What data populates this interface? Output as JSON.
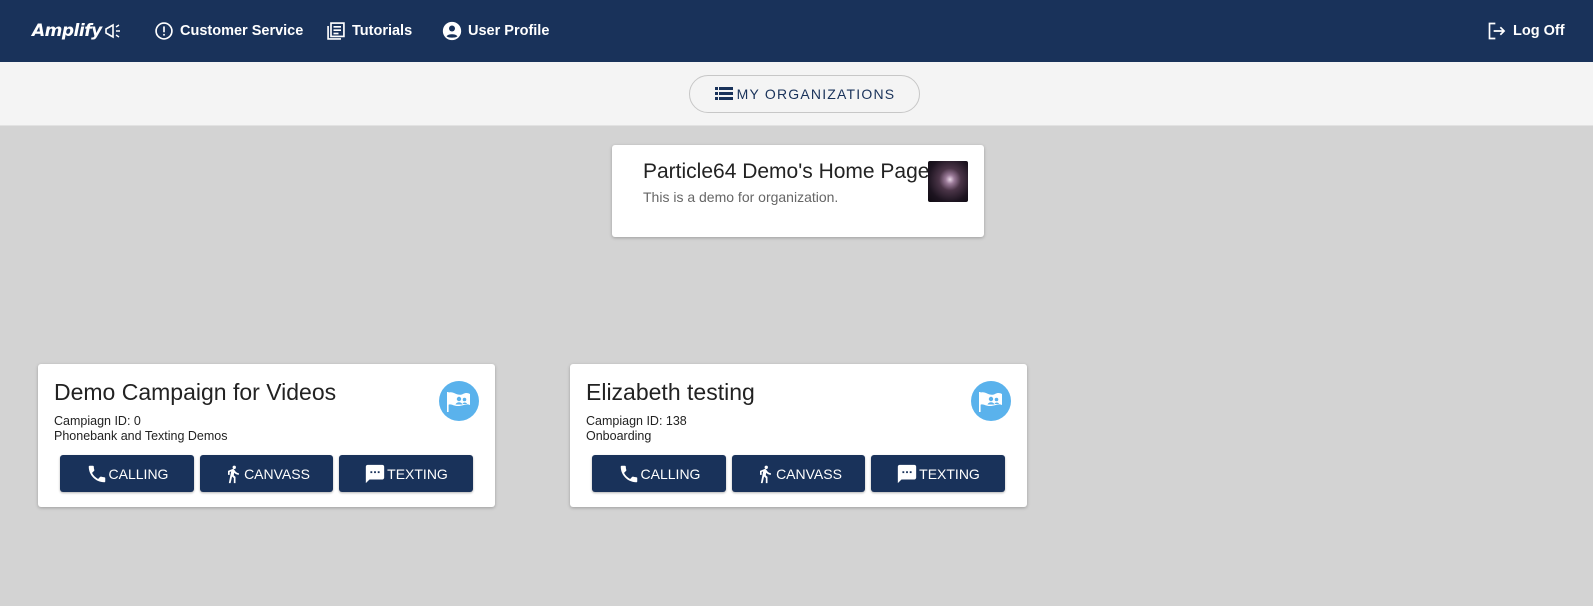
{
  "nav": {
    "logo_text": "Amplify",
    "links": [
      {
        "label": "Customer Service",
        "icon": "alert-circle-icon"
      },
      {
        "label": "Tutorials",
        "icon": "newspaper-icon"
      },
      {
        "label": "User Profile",
        "icon": "account-circle-icon"
      }
    ],
    "logout_label": "Log Off"
  },
  "subheader": {
    "my_orgs_label": "MY ORGANIZATIONS"
  },
  "organization": {
    "title": "Particle64 Demo's Home Page",
    "description": "This is a demo for organization."
  },
  "campaigns": [
    {
      "title": "Demo Campaign for Videos",
      "id_line": "Campiagn ID: 0",
      "subtitle": "Phonebank and Texting Demos",
      "buttons": {
        "calling": "CALLING",
        "canvass": "CANVASS",
        "texting": "TEXTING"
      }
    },
    {
      "title": "Elizabeth testing",
      "id_line": "Campiagn ID: 138",
      "subtitle": "Onboarding",
      "buttons": {
        "calling": "CALLING",
        "canvass": "CANVASS",
        "texting": "TEXTING"
      }
    }
  ],
  "colors": {
    "navy": "#19325a",
    "accent_blue": "#5ab2ec",
    "page_bg": "#d3d3d3"
  }
}
